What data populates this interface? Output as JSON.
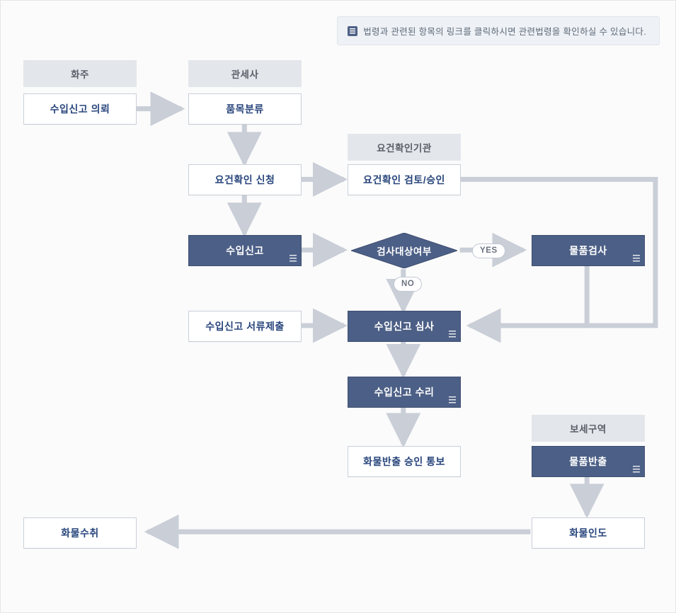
{
  "notice": {
    "text": "법령과 관련된 항목의 링크를 클릭하시면 관련법령을 확인하실 수 있습니다."
  },
  "headers": {
    "shipper": "화주",
    "broker": "관세사",
    "verifier": "요건확인기관",
    "bonded": "보세구역"
  },
  "nodes": {
    "request_import_declaration": "수입신고 의뢰",
    "item_classification": "품목분류",
    "req_check_apply": "요건확인 신청",
    "req_check_review": "요건확인 검토/승인",
    "import_declaration": "수입신고",
    "inspection_target": "검사대상여부",
    "goods_inspection": "물품검사",
    "submit_docs": "수입신고 서류제출",
    "declaration_review": "수입신고 심사",
    "declaration_accept": "수입신고 수리",
    "release_notice": "화물반출 승인 통보",
    "goods_release": "물품반출",
    "cargo_delivery": "화물인도",
    "cargo_receipt": "화물수취"
  },
  "decision_labels": {
    "yes": "YES",
    "no": "NO"
  }
}
